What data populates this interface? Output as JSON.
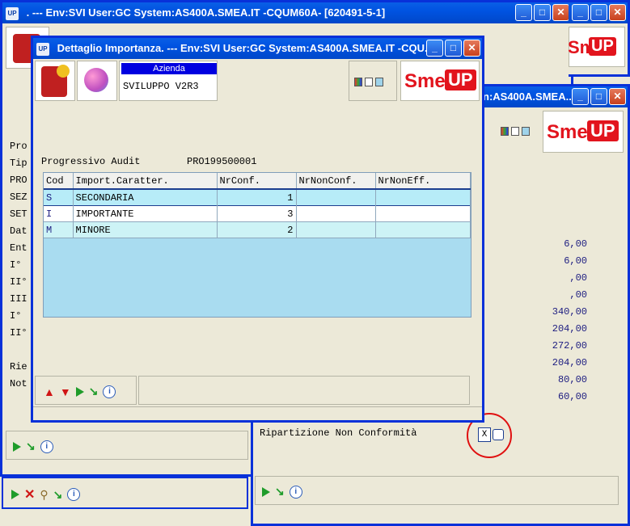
{
  "back_window": {
    "title": ". --- Env:SVI User:GC System:AS400A.SMEA.IT -CQUM60A- [620491-5-1]",
    "app_icon": "UP"
  },
  "mid_window": {
    "title": "n:AS400A.SMEA...",
    "labels": [
      "Pro",
      "Tip",
      "PRO",
      "SEZ",
      "SET",
      "Dat",
      "Ent",
      "I°",
      "II°",
      "III",
      "I°",
      "II°",
      "",
      "Rie",
      "Not"
    ],
    "values": [
      "6,00",
      "6,00",
      ",00",
      ",00",
      "340,00",
      "204,00",
      "272,00",
      "204,00",
      "80,00",
      "60,00"
    ],
    "ripartizione_label": "Ripartizione Non Conformità",
    "checkbox_mark": "X"
  },
  "smeup_logo": {
    "sme": "Sme.",
    "up": "UP"
  },
  "dialog": {
    "title": "Dettaglio Importanza. --- Env:SVI User:GC System:AS400A.SMEA.IT -CQU...",
    "app_icon": "UP",
    "azienda_label": "Azienda",
    "azienda_value": "SVILUPPO V2R3",
    "progressivo_label": "Progressivo Audit",
    "progressivo_value": "PRO199500001",
    "columns": [
      "Cod",
      "Import.Caratter.",
      "NrConf.",
      "NrNonConf.",
      "NrNonEff."
    ],
    "rows": [
      {
        "cod": "S",
        "desc": "SECONDARIA",
        "conf": "1",
        "nonconf": "",
        "noneff": ""
      },
      {
        "cod": "I",
        "desc": "IMPORTANTE",
        "conf": "3",
        "nonconf": "",
        "noneff": ""
      },
      {
        "cod": "M",
        "desc": "MINORE",
        "conf": "2",
        "nonconf": "",
        "noneff": ""
      }
    ]
  },
  "window_buttons": {
    "minimize": "_",
    "maximize": "□",
    "close": "✕"
  },
  "icons": [
    "up-arrow-icon",
    "down-arrow-icon",
    "play-icon",
    "refresh-arrow-icon",
    "info-icon",
    "delete-icon",
    "search-icon"
  ]
}
